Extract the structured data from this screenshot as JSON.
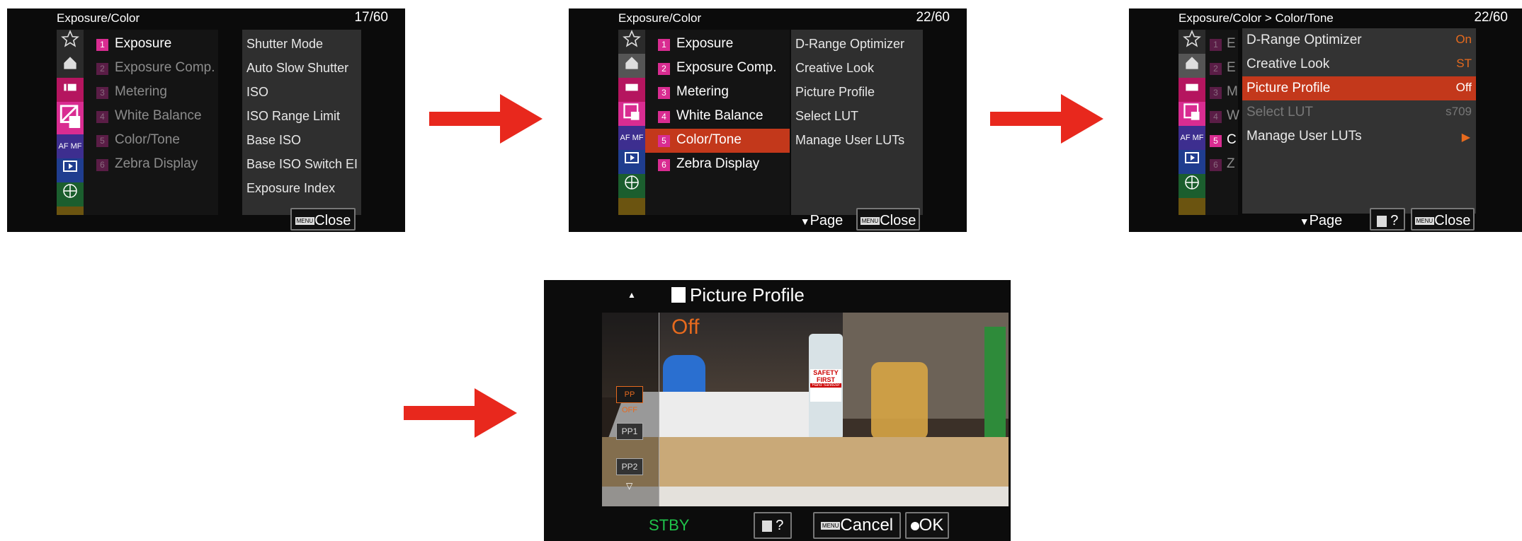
{
  "screen1": {
    "title": "Exposure/Color",
    "page": "17/60",
    "categories": [
      {
        "num": "1",
        "label": "Exposure"
      },
      {
        "num": "2",
        "label": "Exposure Comp."
      },
      {
        "num": "3",
        "label": "Metering"
      },
      {
        "num": "4",
        "label": "White Balance"
      },
      {
        "num": "5",
        "label": "Color/Tone"
      },
      {
        "num": "6",
        "label": "Zebra Display"
      }
    ],
    "items": [
      "Shutter Mode",
      "Auto Slow Shutter",
      "ISO",
      "ISO Range Limit",
      "Base ISO",
      "Base ISO Switch EI",
      "Exposure Index"
    ],
    "close_label": "Close"
  },
  "screen2": {
    "title": "Exposure/Color",
    "page": "22/60",
    "categories": [
      {
        "num": "1",
        "label": "Exposure"
      },
      {
        "num": "2",
        "label": "Exposure Comp."
      },
      {
        "num": "3",
        "label": "Metering"
      },
      {
        "num": "4",
        "label": "White Balance"
      },
      {
        "num": "5",
        "label": "Color/Tone"
      },
      {
        "num": "6",
        "label": "Zebra Display"
      }
    ],
    "items": [
      "D-Range Optimizer",
      "Creative Look",
      "Picture Profile",
      "Select LUT",
      "Manage User LUTs"
    ],
    "page_label": "Page",
    "close_label": "Close"
  },
  "screen3": {
    "title": "Exposure/Color > Color/Tone",
    "page": "22/60",
    "cat_nums": [
      "1",
      "2",
      "3",
      "4",
      "5",
      "6"
    ],
    "cat_frags": [
      "E",
      "E",
      "M",
      "W",
      "C",
      "Z"
    ],
    "items": [
      {
        "label": "D-Range Optimizer",
        "value": "On"
      },
      {
        "label": "Creative Look",
        "value": "ST"
      },
      {
        "label": "Picture Profile",
        "value": "Off"
      },
      {
        "label": "Select LUT",
        "value": "s709"
      },
      {
        "label": "Manage User LUTs",
        "value": ""
      }
    ],
    "page_label": "Page",
    "help_label": "?",
    "close_label": "Close"
  },
  "screen4": {
    "title": "Picture Profile",
    "current": "Off",
    "options": [
      "PP OFF",
      "PP1",
      "PP2"
    ],
    "status": "STBY",
    "help_label": "?",
    "cancel_label": "Cancel",
    "ok_label": "OK",
    "label_safety_1": "SAFETY",
    "label_safety_2": "FIRST",
    "label_sanitizer": "Hand Sanitizer"
  },
  "menu_badge": "MENU",
  "colors": {
    "highlight": "#c3381b",
    "category_magenta": "#d92c91",
    "value_orange": "#e66a1e",
    "arrow_red": "#e8281d",
    "status_green": "#1fc24a"
  }
}
